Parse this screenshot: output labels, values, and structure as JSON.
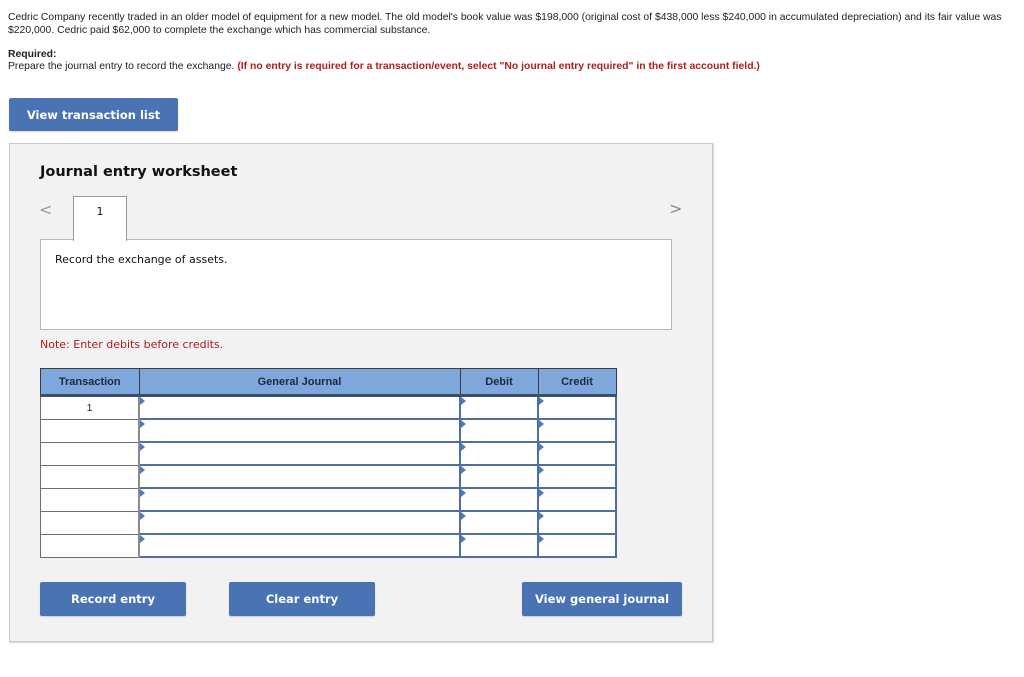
{
  "problem": {
    "text": "Cedric Company recently traded in an older model of equipment for a new model. The old model's book value was $198,000 (original cost of $438,000 less $240,000 in accumulated depreciation) and its fair value was $220,000. Cedric paid $62,000 to complete the exchange which has commercial substance.",
    "required_label": "Required:",
    "required_text": "Prepare the journal entry to record the exchange.",
    "required_note": "(If no entry is required for a transaction/event, select \"No journal entry required\" in the first account field.)"
  },
  "buttons": {
    "view_transaction_list": "View transaction list",
    "record_entry": "Record entry",
    "clear_entry": "Clear entry",
    "view_general_journal": "View general journal"
  },
  "worksheet": {
    "title": "Journal entry worksheet",
    "prev_icon": "chevron-left",
    "next_icon": "chevron-right",
    "prev_glyph": "<",
    "next_glyph": ">",
    "active_tab": "1",
    "description": "Record the exchange of assets.",
    "note": "Note: Enter debits before credits."
  },
  "table": {
    "headers": {
      "transaction": "Transaction",
      "general_journal": "General Journal",
      "debit": "Debit",
      "credit": "Credit"
    },
    "rows": [
      {
        "transaction": "1",
        "account": "",
        "debit": "",
        "credit": ""
      },
      {
        "transaction": "",
        "account": "",
        "debit": "",
        "credit": ""
      },
      {
        "transaction": "",
        "account": "",
        "debit": "",
        "credit": ""
      },
      {
        "transaction": "",
        "account": "",
        "debit": "",
        "credit": ""
      },
      {
        "transaction": "",
        "account": "",
        "debit": "",
        "credit": ""
      },
      {
        "transaction": "",
        "account": "",
        "debit": "",
        "credit": ""
      },
      {
        "transaction": "",
        "account": "",
        "debit": "",
        "credit": ""
      }
    ]
  },
  "colors": {
    "button_blue": "#4a73b3",
    "header_blue": "#7fa7dc",
    "note_red": "#a31f1f",
    "panel_bg": "#f2f2f2"
  }
}
